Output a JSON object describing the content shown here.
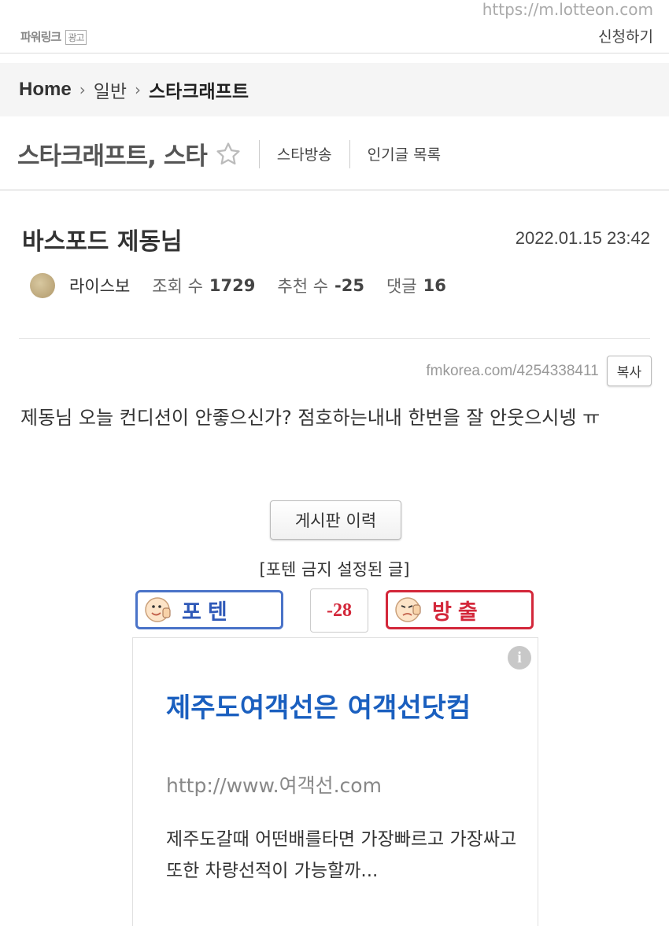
{
  "ad_strip": {
    "powerlink": "파워링크",
    "ad_tag": "광고",
    "url": "https://m.lotteon.com",
    "apply": "신청하기"
  },
  "breadcrumb": {
    "home": "Home",
    "level1": "일반",
    "level2": "스타크래프트"
  },
  "board": {
    "title": "스타크래프트, 스타",
    "link1": "스타방송",
    "link2": "인기글 목록"
  },
  "post": {
    "title": "바스포드 제동님",
    "date": "2022.01.15 23:42",
    "author": "라이스보",
    "views_label": "조회 수",
    "views": "1729",
    "recommend_label": "추천 수",
    "recommend": "-25",
    "comments_label": "댓글",
    "comments": "16",
    "source_url": "fmkorea.com/4254338411",
    "copy_label": "복사",
    "content": "제동님 오늘 컨디션이 안좋으신가? 점호하는내내 한번을 잘 안웃으시넹 ㅠ"
  },
  "actions": {
    "history_button": "게시판 이력",
    "notice": "[포텐 금지 설정된 글]",
    "upvote_label": "포텐",
    "downvote_label": "방출",
    "vote_count": "-28"
  },
  "ad_card": {
    "info": "i",
    "title": "제주도여객선은 여객선닷컴",
    "link": "http://www.여객선.com",
    "description": "제주도갈때 어떤배를타면 가장빠르고 가장싸고 또한 차량선적이 가능할까..."
  },
  "colors": {
    "upvote": "#4a73c8",
    "downvote": "#d3273a",
    "ad_title": "#1a5fbf"
  }
}
